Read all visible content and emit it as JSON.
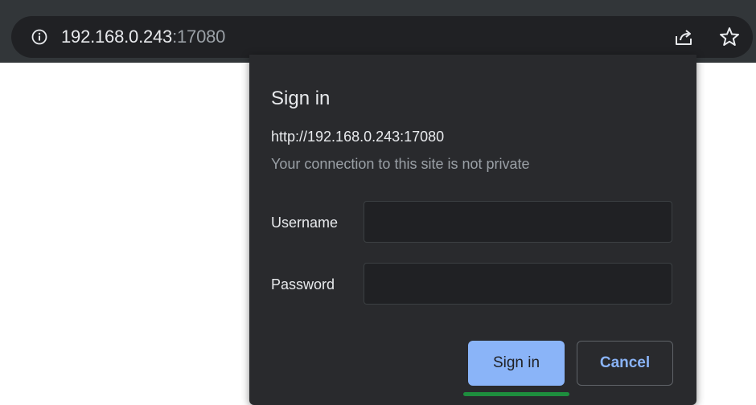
{
  "address_bar": {
    "url_host": "192.168.0.243",
    "url_port": ":17080",
    "info_icon": "info-icon",
    "share_icon": "share-icon",
    "bookmark_icon": "star-icon"
  },
  "dialog": {
    "title": "Sign in",
    "origin": "http://192.168.0.243:17080",
    "warning": "Your connection to this site is not private",
    "username_label": "Username",
    "username_value": "",
    "password_label": "Password",
    "password_value": "",
    "signin_label": "Sign in",
    "cancel_label": "Cancel"
  },
  "colors": {
    "toolbar_bg": "#323639",
    "omnibox_bg": "#202124",
    "dialog_bg": "#292a2d",
    "primary_button": "#8ab4f8",
    "focus_indicator": "#1e8e3e"
  }
}
